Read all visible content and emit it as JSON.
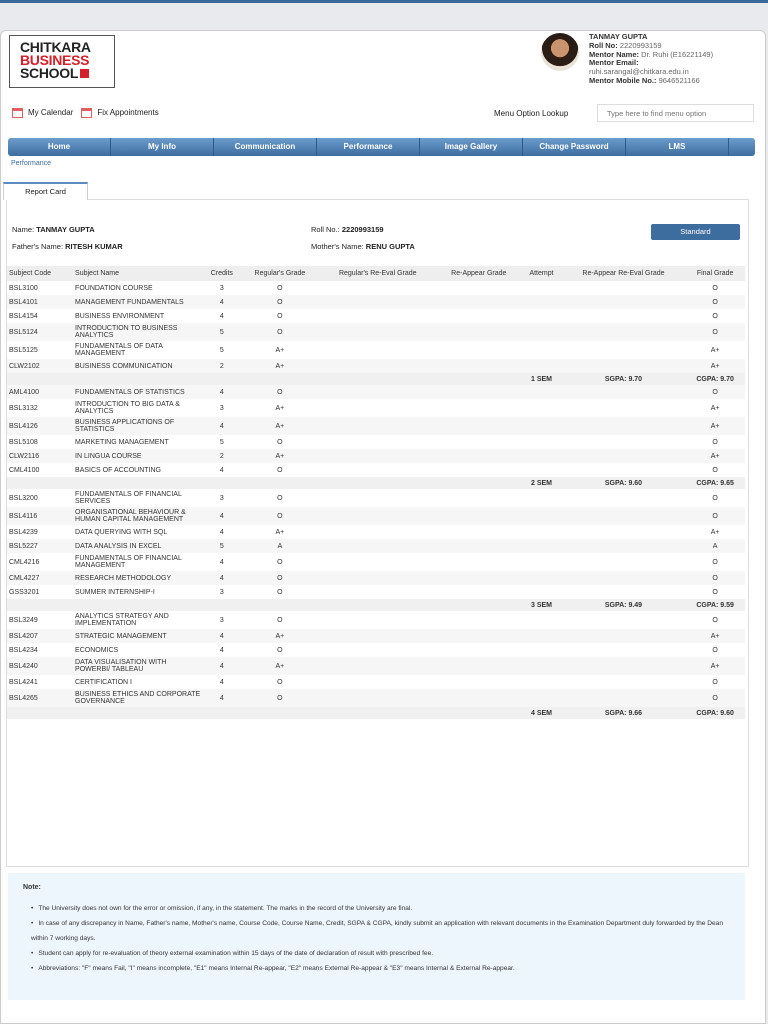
{
  "logo": {
    "line1": "CHITKARA",
    "line2": "BUSINESS",
    "line3": "SCHOOL"
  },
  "user": {
    "name": "TANMAY GUPTA",
    "roll_label": "Roll No:",
    "roll": "2220993159",
    "mentor_label": "Mentor Name:",
    "mentor": "Dr. Ruhi (E16221149)",
    "email_label": "Mentor Email:",
    "email": "ruhi.sarangal@chitkara.edu.in",
    "mobile_label": "Mentor Mobile No.:",
    "mobile": "9646521166"
  },
  "links": {
    "calendar": "My Calendar",
    "appointments": "Fix Appointments"
  },
  "lookup": {
    "label": "Menu Option Lookup",
    "placeholder": "Type here to find menu option"
  },
  "nav": [
    "Home",
    "My Info",
    "Communication",
    "Performance",
    "Image Gallery",
    "Change Password",
    "LMS"
  ],
  "breadcrumb": "Performance",
  "tab": "Report Card",
  "student": {
    "name_label": "Name:",
    "name": "TANMAY GUPTA",
    "roll_label": "Roll No.:",
    "roll": "2220993159",
    "father_label": "Father's Name:",
    "father": "RITESH KUMAR",
    "mother_label": "Mother's Name:",
    "mother": "RENU GUPTA",
    "standard_button": "Standard"
  },
  "table": {
    "headers": [
      "Subject Code",
      "Subject Name",
      "Credits",
      "Regular's Grade",
      "Regular's Re-Eval Grade",
      "Re-Appear Grade",
      "Attempt",
      "Re-Appear Re-Eval Grade",
      "Final Grade"
    ],
    "rows": [
      {
        "code": "BSL3100",
        "name": "FOUNDATION COURSE",
        "credits": "3",
        "grade": "O",
        "final": "O"
      },
      {
        "code": "BSL4101",
        "name": "MANAGEMENT FUNDAMENTALS",
        "credits": "4",
        "grade": "O",
        "final": "O"
      },
      {
        "code": "BSL4154",
        "name": "BUSINESS ENVIRONMENT",
        "credits": "4",
        "grade": "O",
        "final": "O"
      },
      {
        "code": "BSL5124",
        "name": "INTRODUCTION TO BUSINESS ANALYTICS",
        "credits": "5",
        "grade": "O",
        "final": "O"
      },
      {
        "code": "BSL5125",
        "name": "FUNDAMENTALS OF DATA MANAGEMENT",
        "credits": "5",
        "grade": "A+",
        "final": "A+"
      },
      {
        "code": "CLW2102",
        "name": "BUSINESS COMMUNICATION",
        "credits": "2",
        "grade": "A+",
        "final": "A+"
      },
      {
        "sem": "1 SEM",
        "sgpa": "SGPA: 9.70",
        "cgpa": "CGPA: 9.70"
      },
      {
        "code": "AML4100",
        "name": "FUNDAMENTALS OF STATISTICS",
        "credits": "4",
        "grade": "O",
        "final": "O"
      },
      {
        "code": "BSL3132",
        "name": "INTRODUCTION TO BIG DATA & ANALYTICS",
        "credits": "3",
        "grade": "A+",
        "final": "A+"
      },
      {
        "code": "BSL4126",
        "name": "BUSINESS APPLICATIONS OF STATISTICS",
        "credits": "4",
        "grade": "A+",
        "final": "A+"
      },
      {
        "code": "BSL5108",
        "name": "MARKETING MANAGEMENT",
        "credits": "5",
        "grade": "O",
        "final": "O"
      },
      {
        "code": "CLW2116",
        "name": "IN LINGUA COURSE",
        "credits": "2",
        "grade": "A+",
        "final": "A+"
      },
      {
        "code": "CML4100",
        "name": "BASICS OF ACCOUNTING",
        "credits": "4",
        "grade": "O",
        "final": "O"
      },
      {
        "sem": "2 SEM",
        "sgpa": "SGPA: 9.60",
        "cgpa": "CGPA: 9.65"
      },
      {
        "code": "BSL3200",
        "name": "FUNDAMENTALS OF FINANCIAL SERVICES",
        "credits": "3",
        "grade": "O",
        "final": "O"
      },
      {
        "code": "BSL4116",
        "name": "ORGANISATIONAL BEHAVIOUR & HUMAN CAPITAL MANAGEMENT",
        "credits": "4",
        "grade": "O",
        "final": "O"
      },
      {
        "code": "BSL4239",
        "name": "DATA QUERYING WITH SQL",
        "credits": "4",
        "grade": "A+",
        "final": "A+"
      },
      {
        "code": "BSL5227",
        "name": "DATA ANALYSIS IN EXCEL",
        "credits": "5",
        "grade": "A",
        "final": "A"
      },
      {
        "code": "CML4216",
        "name": "FUNDAMENTALS OF FINANCIAL MANAGEMENT",
        "credits": "4",
        "grade": "O",
        "final": "O"
      },
      {
        "code": "CML4227",
        "name": "RESEARCH METHODOLOGY",
        "credits": "4",
        "grade": "O",
        "final": "O"
      },
      {
        "code": "GSS3201",
        "name": "SUMMER INTERNSHIP-I",
        "credits": "3",
        "grade": "O",
        "final": "O"
      },
      {
        "sem": "3 SEM",
        "sgpa": "SGPA: 9.49",
        "cgpa": "CGPA: 9.59"
      },
      {
        "code": "BSL3249",
        "name": "ANALYTICS STRATEGY AND IMPLEMENTATION",
        "credits": "3",
        "grade": "O",
        "final": "O"
      },
      {
        "code": "BSL4207",
        "name": "STRATEGIC MANAGEMENT",
        "credits": "4",
        "grade": "A+",
        "final": "A+"
      },
      {
        "code": "BSL4234",
        "name": "ECONOMICS",
        "credits": "4",
        "grade": "O",
        "final": "O"
      },
      {
        "code": "BSL4240",
        "name": "DATA VISUALISATION WITH POWERBI/ TABLEAU",
        "credits": "4",
        "grade": "A+",
        "final": "A+"
      },
      {
        "code": "BSL4241",
        "name": "CERTIFICATION I",
        "credits": "4",
        "grade": "O",
        "final": "O"
      },
      {
        "code": "BSL4265",
        "name": "BUSINESS ETHICS AND CORPORATE GOVERNANCE",
        "credits": "4",
        "grade": "O",
        "final": "O"
      },
      {
        "sem": "4 SEM",
        "sgpa": "SGPA: 9.66",
        "cgpa": "CGPA: 9.60"
      }
    ]
  },
  "note": {
    "title": "Note:",
    "items": [
      "The University does not own for the error or omission, if any, in the statement. The marks in the record of the University are final.",
      "In case of any discrepancy in Name, Father's name, Mother's name, Course Code, Course Name, Credit, SGPA & CGPA, kindly submit an application with relevant documents in the Examination Department duly forwarded by the Dean within 7 working days.",
      "Student can apply for re-evaluation of theory external examination within 15 days of the date of declaration of result with prescribed fee.",
      "Abbreviations: \"F\" means Fail, \"I\" means incomplete, \"E1\" means Internal Re-appear, \"E2\" means External Re-appear & \"E3\" means Internal & External Re-appear."
    ]
  }
}
